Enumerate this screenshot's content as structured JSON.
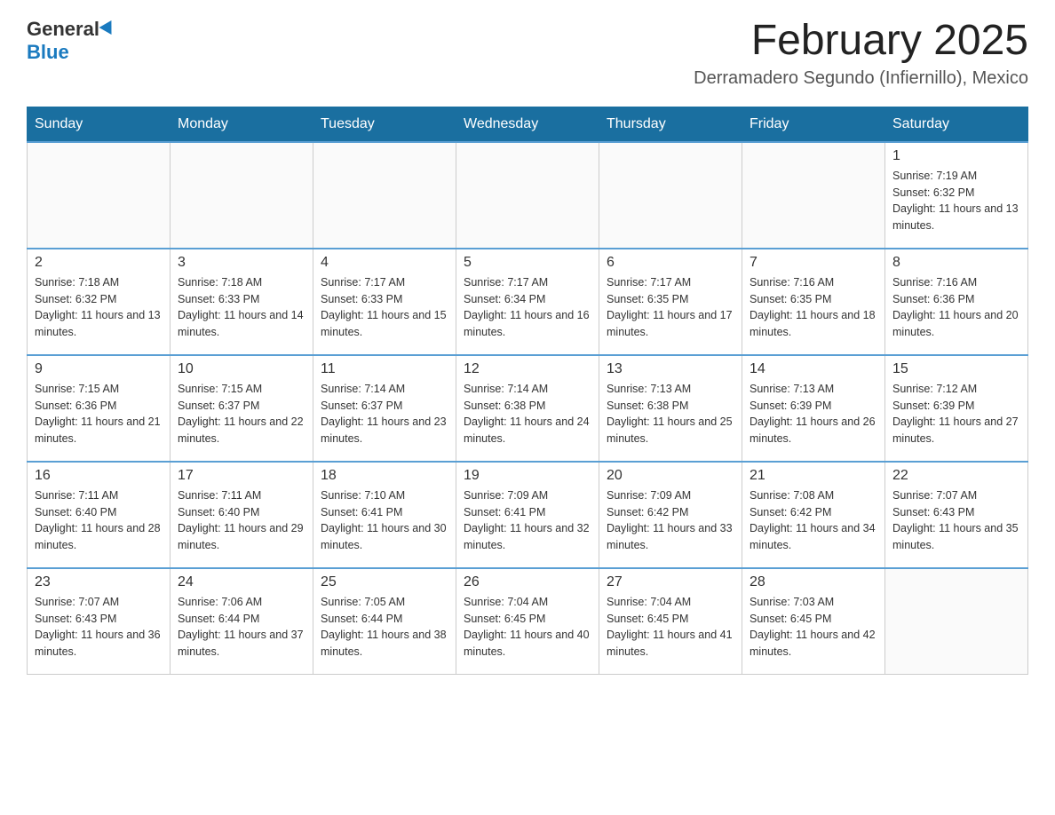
{
  "logo": {
    "general": "General",
    "blue": "Blue"
  },
  "header": {
    "month_title": "February 2025",
    "location": "Derramadero Segundo (Infiernillo), Mexico"
  },
  "days_of_week": [
    "Sunday",
    "Monday",
    "Tuesday",
    "Wednesday",
    "Thursday",
    "Friday",
    "Saturday"
  ],
  "weeks": [
    [
      {
        "day": "",
        "info": ""
      },
      {
        "day": "",
        "info": ""
      },
      {
        "day": "",
        "info": ""
      },
      {
        "day": "",
        "info": ""
      },
      {
        "day": "",
        "info": ""
      },
      {
        "day": "",
        "info": ""
      },
      {
        "day": "1",
        "info": "Sunrise: 7:19 AM\nSunset: 6:32 PM\nDaylight: 11 hours and 13 minutes."
      }
    ],
    [
      {
        "day": "2",
        "info": "Sunrise: 7:18 AM\nSunset: 6:32 PM\nDaylight: 11 hours and 13 minutes."
      },
      {
        "day": "3",
        "info": "Sunrise: 7:18 AM\nSunset: 6:33 PM\nDaylight: 11 hours and 14 minutes."
      },
      {
        "day": "4",
        "info": "Sunrise: 7:17 AM\nSunset: 6:33 PM\nDaylight: 11 hours and 15 minutes."
      },
      {
        "day": "5",
        "info": "Sunrise: 7:17 AM\nSunset: 6:34 PM\nDaylight: 11 hours and 16 minutes."
      },
      {
        "day": "6",
        "info": "Sunrise: 7:17 AM\nSunset: 6:35 PM\nDaylight: 11 hours and 17 minutes."
      },
      {
        "day": "7",
        "info": "Sunrise: 7:16 AM\nSunset: 6:35 PM\nDaylight: 11 hours and 18 minutes."
      },
      {
        "day": "8",
        "info": "Sunrise: 7:16 AM\nSunset: 6:36 PM\nDaylight: 11 hours and 20 minutes."
      }
    ],
    [
      {
        "day": "9",
        "info": "Sunrise: 7:15 AM\nSunset: 6:36 PM\nDaylight: 11 hours and 21 minutes."
      },
      {
        "day": "10",
        "info": "Sunrise: 7:15 AM\nSunset: 6:37 PM\nDaylight: 11 hours and 22 minutes."
      },
      {
        "day": "11",
        "info": "Sunrise: 7:14 AM\nSunset: 6:37 PM\nDaylight: 11 hours and 23 minutes."
      },
      {
        "day": "12",
        "info": "Sunrise: 7:14 AM\nSunset: 6:38 PM\nDaylight: 11 hours and 24 minutes."
      },
      {
        "day": "13",
        "info": "Sunrise: 7:13 AM\nSunset: 6:38 PM\nDaylight: 11 hours and 25 minutes."
      },
      {
        "day": "14",
        "info": "Sunrise: 7:13 AM\nSunset: 6:39 PM\nDaylight: 11 hours and 26 minutes."
      },
      {
        "day": "15",
        "info": "Sunrise: 7:12 AM\nSunset: 6:39 PM\nDaylight: 11 hours and 27 minutes."
      }
    ],
    [
      {
        "day": "16",
        "info": "Sunrise: 7:11 AM\nSunset: 6:40 PM\nDaylight: 11 hours and 28 minutes."
      },
      {
        "day": "17",
        "info": "Sunrise: 7:11 AM\nSunset: 6:40 PM\nDaylight: 11 hours and 29 minutes."
      },
      {
        "day": "18",
        "info": "Sunrise: 7:10 AM\nSunset: 6:41 PM\nDaylight: 11 hours and 30 minutes."
      },
      {
        "day": "19",
        "info": "Sunrise: 7:09 AM\nSunset: 6:41 PM\nDaylight: 11 hours and 32 minutes."
      },
      {
        "day": "20",
        "info": "Sunrise: 7:09 AM\nSunset: 6:42 PM\nDaylight: 11 hours and 33 minutes."
      },
      {
        "day": "21",
        "info": "Sunrise: 7:08 AM\nSunset: 6:42 PM\nDaylight: 11 hours and 34 minutes."
      },
      {
        "day": "22",
        "info": "Sunrise: 7:07 AM\nSunset: 6:43 PM\nDaylight: 11 hours and 35 minutes."
      }
    ],
    [
      {
        "day": "23",
        "info": "Sunrise: 7:07 AM\nSunset: 6:43 PM\nDaylight: 11 hours and 36 minutes."
      },
      {
        "day": "24",
        "info": "Sunrise: 7:06 AM\nSunset: 6:44 PM\nDaylight: 11 hours and 37 minutes."
      },
      {
        "day": "25",
        "info": "Sunrise: 7:05 AM\nSunset: 6:44 PM\nDaylight: 11 hours and 38 minutes."
      },
      {
        "day": "26",
        "info": "Sunrise: 7:04 AM\nSunset: 6:45 PM\nDaylight: 11 hours and 40 minutes."
      },
      {
        "day": "27",
        "info": "Sunrise: 7:04 AM\nSunset: 6:45 PM\nDaylight: 11 hours and 41 minutes."
      },
      {
        "day": "28",
        "info": "Sunrise: 7:03 AM\nSunset: 6:45 PM\nDaylight: 11 hours and 42 minutes."
      },
      {
        "day": "",
        "info": ""
      }
    ]
  ]
}
